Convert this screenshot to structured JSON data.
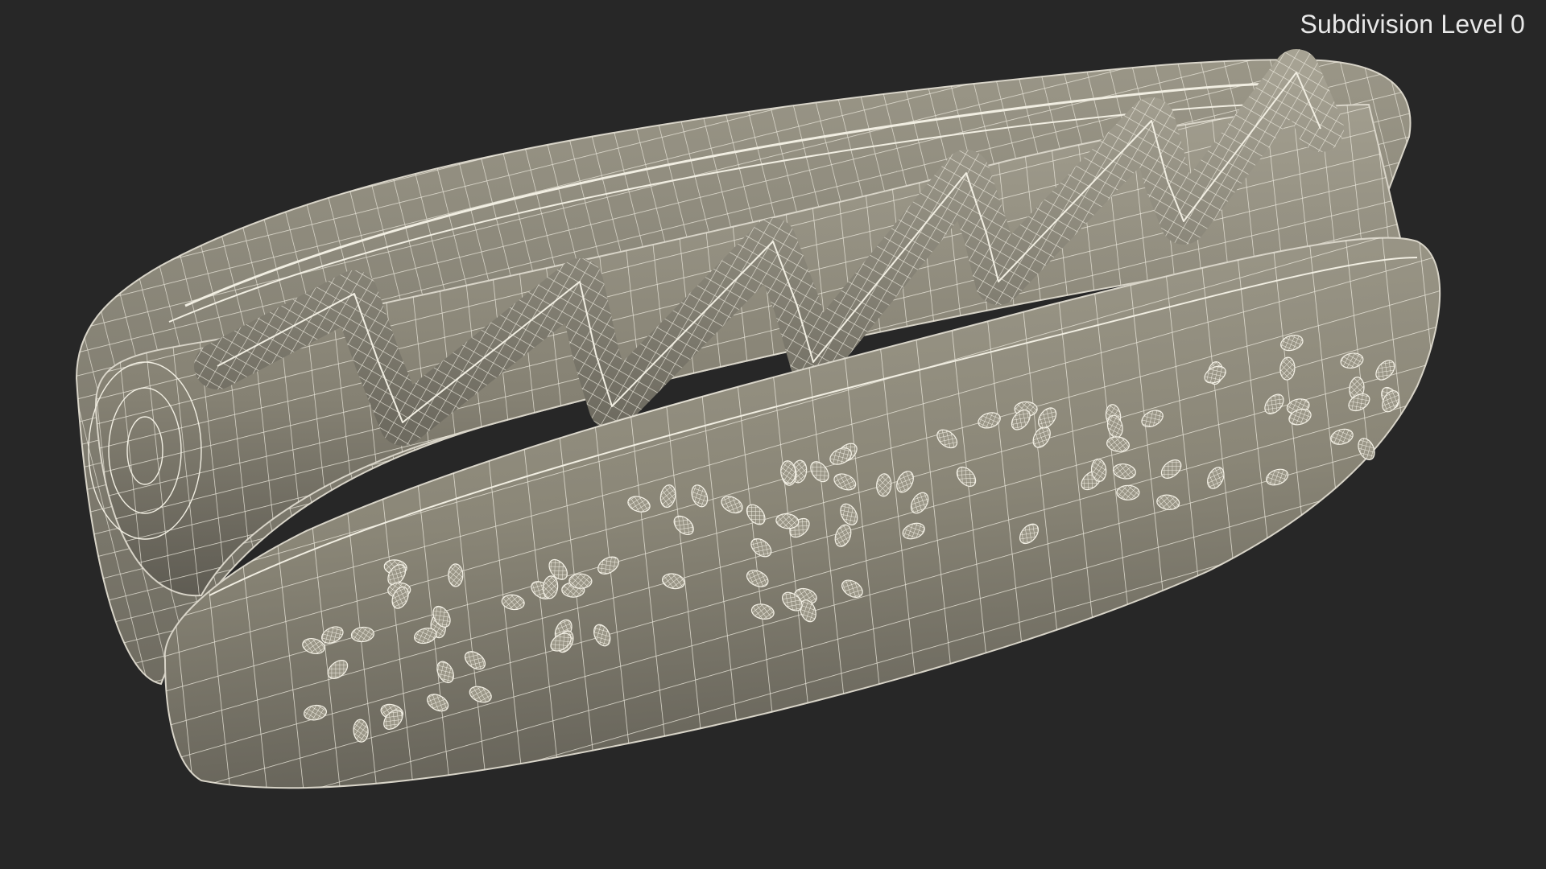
{
  "overlay": {
    "subdivision_label": "Subdivision Level 0"
  },
  "viewport": {
    "background_color": "#272727",
    "mesh_fill_color": "#8a8677",
    "wire_color": "#f4f1e6"
  },
  "model": {
    "icon": "hotdog-wireframe-mesh"
  }
}
